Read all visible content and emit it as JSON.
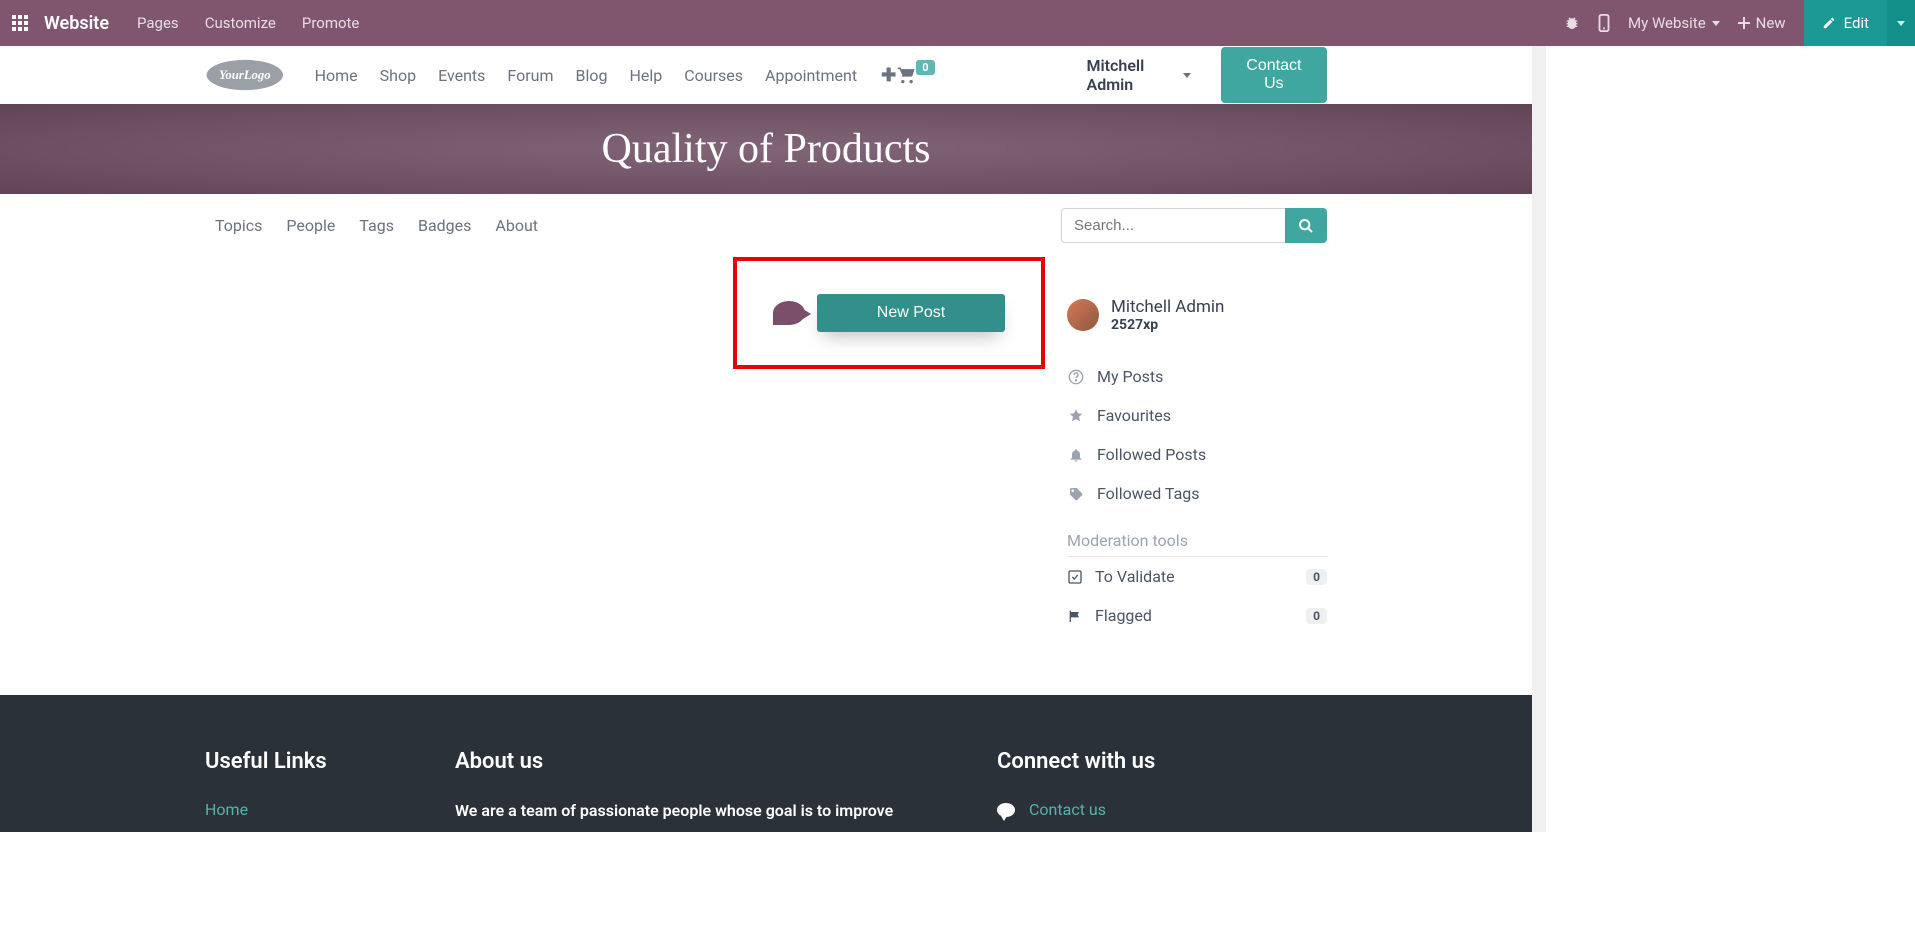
{
  "admin_bar": {
    "brand": "Website",
    "menu": {
      "pages": "Pages",
      "customize": "Customize",
      "promote": "Promote"
    },
    "site_switcher": "My Website",
    "new": "New",
    "edit": "Edit"
  },
  "site_nav": {
    "items": {
      "home": "Home",
      "shop": "Shop",
      "events": "Events",
      "forum": "Forum",
      "blog": "Blog",
      "help": "Help",
      "courses": "Courses",
      "appointment": "Appointment"
    },
    "cart_count": "0",
    "user": "Mitchell Admin",
    "contact": "Contact Us"
  },
  "hero": {
    "title": "Quality of Products"
  },
  "forum_nav": {
    "topics": "Topics",
    "people": "People",
    "tags": "Tags",
    "badges": "Badges",
    "about": "About"
  },
  "search": {
    "placeholder": "Search..."
  },
  "new_post": {
    "label": "New Post"
  },
  "sidebar": {
    "user": {
      "name": "Mitchell Admin",
      "xp": "2527xp"
    },
    "items": {
      "my_posts": "My Posts",
      "favourites": "Favourites",
      "followed_posts": "Followed Posts",
      "followed_tags": "Followed Tags"
    },
    "moderation_heading": "Moderation tools",
    "moderation": {
      "to_validate": {
        "label": "To Validate",
        "count": "0"
      },
      "flagged": {
        "label": "Flagged",
        "count": "0"
      }
    }
  },
  "footer": {
    "links": {
      "heading": "Useful Links",
      "home": "Home"
    },
    "about": {
      "heading": "About us",
      "text": "We are a team of passionate people whose goal is to improve"
    },
    "connect": {
      "heading": "Connect with us",
      "contact": "Contact us"
    }
  }
}
